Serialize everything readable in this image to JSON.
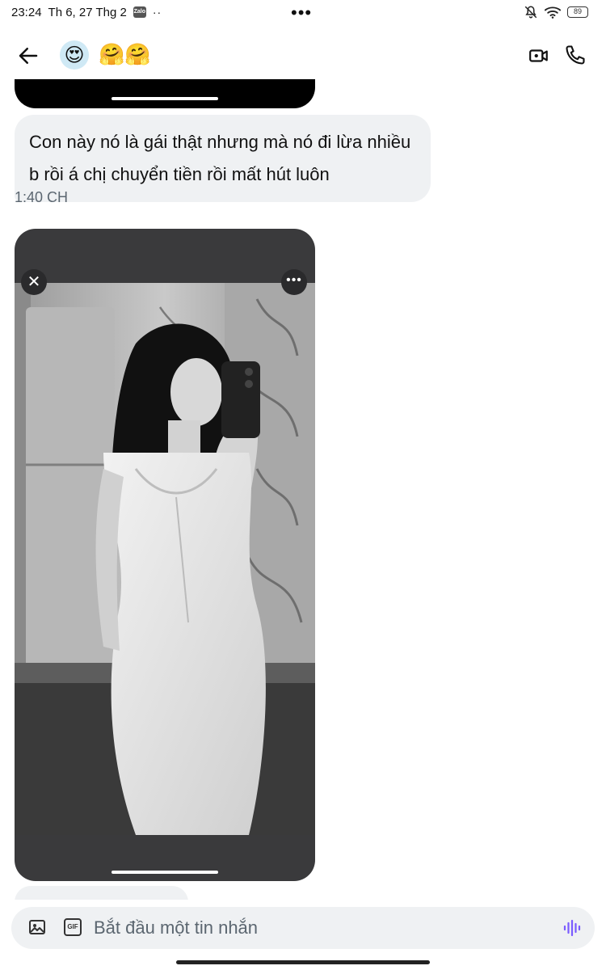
{
  "status_bar": {
    "time": "23:24",
    "date": "Th 6, 27 Thg 2",
    "app_badge": "Zalo",
    "more_dots": "•••",
    "battery": "89"
  },
  "header": {
    "avatar_emoji": "😍",
    "title": "🤗🤗"
  },
  "messages": [
    {
      "text": "Con này nó là gái thật nhưng mà nó đi lừa nhiều b rồi á chị chuyển tiền rồi mất hút luôn",
      "time": "1:40 CH"
    }
  ],
  "media": {
    "close_label": "✕",
    "more_label": "•••"
  },
  "composer": {
    "placeholder": "Bắt đầu một tin nhắn",
    "gif_label": "GIF"
  },
  "colors": {
    "bubble_bg": "#eff1f3",
    "media_bg": "#3a3a3c",
    "accent_purple": "#7b5cff"
  }
}
